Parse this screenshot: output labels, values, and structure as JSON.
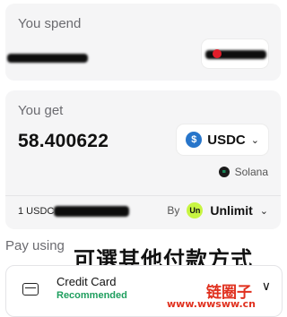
{
  "spend": {
    "label": "You spend"
  },
  "get": {
    "label": "You get",
    "amount": "58.400622",
    "currency": "USDC",
    "currency_icon": "usdc-icon",
    "currency_icon_glyph": "$",
    "network": "Solana",
    "network_icon": "solana-icon",
    "rate_prefix": "1 USDC",
    "provider_by": "By",
    "provider_icon_text": "Un",
    "provider_name": "Unlimit",
    "chevron": "⌄"
  },
  "pay": {
    "label": "Pay using",
    "overlay_caption": "可選其他付款方式",
    "method_title": "Credit Card",
    "method_badge": "Recommended",
    "colors": {
      "recommended": "#1e9e5e"
    }
  },
  "watermark": {
    "cn": "链圈子",
    "url": "www.wwsww.cn"
  }
}
